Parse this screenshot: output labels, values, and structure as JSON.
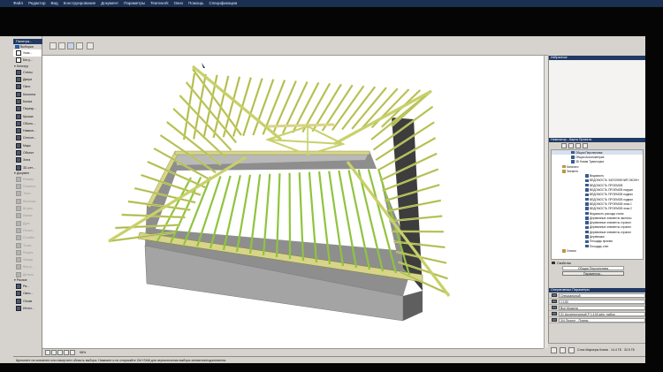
{
  "menubar": {
    "items": [
      "Файл",
      "Редактор",
      "Вид",
      "Конструирование",
      "Документ",
      "Параметры",
      "Teamwork",
      "Окно",
      "Помощь",
      "Спецификации"
    ]
  },
  "left_palette": {
    "title": "Палитра...",
    "selector": {
      "label": "Выборка"
    },
    "arrow_tool": {
      "label": "Указ..."
    },
    "cursor_tool": {
      "label": "Бег.у..."
    },
    "sections": [
      {
        "label": "Констру",
        "tools": [
          "Стены",
          "Двери",
          "Окно",
          "Колонна",
          "Балка",
          "Перекр...",
          "Крыша",
          "Оболо...",
          "Навесн...",
          "Сеточн...",
          "Марк",
          "Объект",
          "Зона",
          "3D-сет..."
        ]
      },
      {
        "label": "Докумен",
        "tools": [
          "Размер",
          "Отметка",
          "Текст",
          "Выноска",
          "Штрих.",
          "Линии",
          "Дуга",
          "Полил...",
          "Сплайн",
          "Точка",
          "Разрез",
          "Фасад",
          "Внутр...",
          "Деталь"
        ]
      },
      {
        "label": "Разное",
        "tools": [
          "Ра...",
          "Окно...",
          "Оглав.",
          "Источ..."
        ]
      }
    ]
  },
  "favorites_panel": {
    "title": "Избранное"
  },
  "navigator": {
    "title": "Навигатор - Карта Проекта",
    "tree": [
      {
        "label": "Общая Перспектива",
        "selected": true,
        "folder": false
      },
      {
        "label": "Общая Аксонометрия",
        "folder": false
      },
      {
        "label": "3D Новая Траектория",
        "folder": false
      },
      {
        "label": "Каталоги",
        "folder": true
      },
      {
        "label": "Элемент",
        "folder": true
      },
      {
        "label": "Ведомость",
        "folder": false
      },
      {
        "label": "ВЕДОМОСТЬ ЗАПОЛНЕНИЯ ОКОНН",
        "folder": false
      },
      {
        "label": "ВЕДОМОСТЬ ПРОЕМОВ",
        "folder": false
      },
      {
        "label": "ВЕДОМОСТЬ ПРОЕМОВ наружн",
        "folder": false
      },
      {
        "label": "ВЕДОМОСТЬ ПРОЕМОВ подвал",
        "folder": false
      },
      {
        "label": "ВЕДОМОСТЬ ПРОЕМОВ подвал",
        "folder": false
      },
      {
        "label": "ВЕДОМОСТЬ ПРОЕМОВ этаж 1",
        "folder": false
      },
      {
        "label": "ВЕДОМОСТЬ ПРОЕМОВ этаж 2",
        "folder": false
      },
      {
        "label": "Ведомость расхода стали",
        "folder": false
      },
      {
        "label": "Деревянные элементы настилы",
        "folder": false
      },
      {
        "label": "Деревянные элементы стропил",
        "folder": false
      },
      {
        "label": "Деревянные элементы стропил",
        "folder": false
      },
      {
        "label": "Деревянные элементы стропил",
        "folder": false
      },
      {
        "label": "Деревяшки",
        "folder": false
      },
      {
        "label": "Площадь проема",
        "folder": false
      },
      {
        "label": "Площадь стен",
        "folder": false
      },
      {
        "label": "Списки",
        "folder": true
      }
    ]
  },
  "properties": {
    "title": "Свойства",
    "view_name": "Общая Перспектива",
    "params_button": "Параметры..."
  },
  "options_panel": {
    "title": "Оперативные Параметры",
    "rows": [
      "Специальный",
      "1:100",
      "Все Модели",
      "01 Архитектурный Р 1:100 жёл. набор",
      "3/4 Проект - Планы"
    ]
  },
  "quick_opts": {
    "items": [
      "Слои Маркеры Копия",
      "14.4 ГБ",
      "32.5 ГБ"
    ]
  },
  "status_bar": {
    "text": "Щелкните на элементе или начертите область выбора. Нажмите и не отпускайте Ctrl+Shift для переключения выбора элемента/подэлемента."
  },
  "hscroll": {
    "zoom": "98%"
  },
  "colors": {
    "rafter": "#c8d06a",
    "rafter_edge": "#7c8a2c",
    "green_rafter": "#8fc43e",
    "wall": "#8e8e8e",
    "wall_dark": "#5f5f5f",
    "purlin": "#d8d48a"
  }
}
